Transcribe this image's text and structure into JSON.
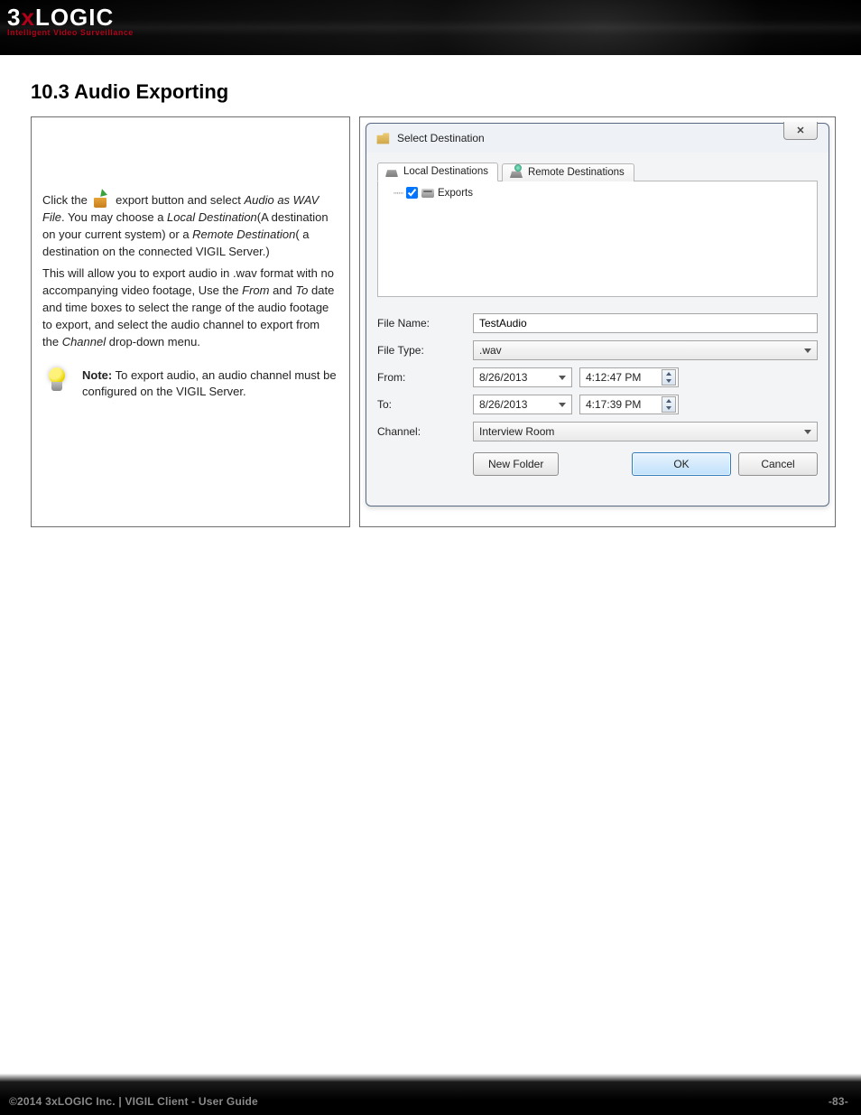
{
  "brand": {
    "name_html": "3xLOGIC",
    "tagline": "Intelligent Video Surveillance"
  },
  "section_title": "10.3 Audio Exporting",
  "body": {
    "p1_a": "Click the ",
    "p1_b": " export button and select ",
    "p1_em1": "Audio as WAV File",
    "p1_c": ". You may choose a ",
    "p1_em2": "Local Destination",
    "p1_d": "(A destination on your current system) or a ",
    "p1_em3": "Remote Destination",
    "p1_e": "( a destination on the connected VIGIL Server.)",
    "p2_a": "This will allow you to export audio in .wav format with no accompanying video footage, Use the ",
    "p2_em1": "From",
    "p2_b": " and ",
    "p2_em2": "To",
    "p2_c": " date and time boxes to select the range of the audio footage to export, and select the audio channel to export from the ",
    "p2_em3": "Channel",
    "p2_d": " drop-down menu.",
    "note_label": "Note:",
    "note_text": " To export audio, an audio channel must be configured on the VIGIL Server."
  },
  "dialog": {
    "title": "Select Destination",
    "close_glyph": "✕",
    "tabs": {
      "local": "Local Destinations",
      "remote": "Remote Destinations"
    },
    "tree": {
      "item1": "Exports"
    },
    "labels": {
      "file_name": "File Name:",
      "file_type": "File Type:",
      "from": "From:",
      "to": "To:",
      "channel": "Channel:"
    },
    "values": {
      "file_name": "TestAudio",
      "file_type": ".wav",
      "from_date": "8/26/2013",
      "from_time": "4:12:47 PM",
      "to_date": "8/26/2013",
      "to_time": "4:17:39 PM",
      "channel": "Interview Room"
    },
    "buttons": {
      "new_folder": "New Folder",
      "ok": "OK",
      "cancel": "Cancel"
    }
  },
  "footer": {
    "left": "©2014 3xLOGIC Inc.  |  VIGIL Client - User Guide",
    "right": "-83-"
  }
}
